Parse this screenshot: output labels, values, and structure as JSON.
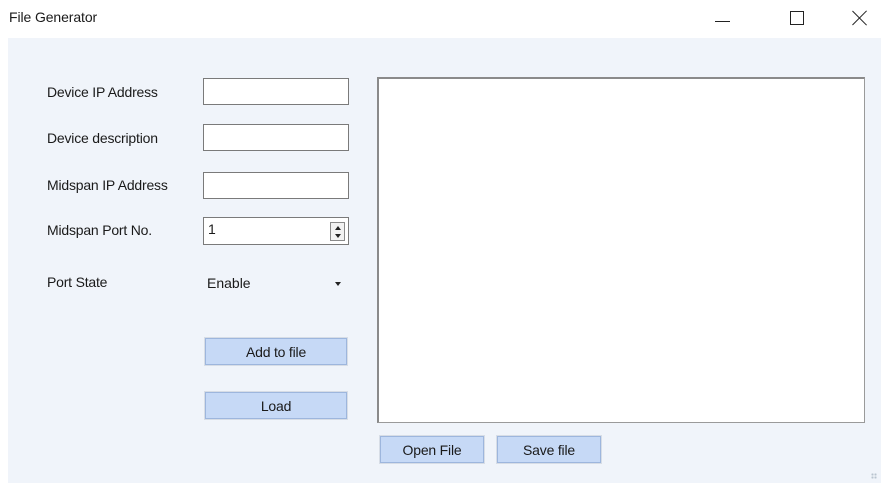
{
  "window": {
    "title": "File Generator"
  },
  "form": {
    "device_ip_label": "Device IP Address",
    "device_ip_value": "",
    "device_desc_label": "Device description",
    "device_desc_value": "",
    "midspan_ip_label": "Midspan IP Address",
    "midspan_ip_value": "",
    "midspan_port_label": "Midspan Port No.",
    "midspan_port_value": "1",
    "port_state_label": "Port State",
    "port_state_value": "Enable"
  },
  "buttons": {
    "add_to_file": "Add to file",
    "load": "Load",
    "open_file": "Open File",
    "save_file": "Save file"
  },
  "output": {
    "text": ""
  },
  "colors": {
    "client_bg": "#f0f4fa",
    "button_bg": "#c6d9f6",
    "button_border": "#9db6dd"
  },
  "icons": {
    "minimize": "minimize-icon",
    "maximize": "maximize-icon",
    "close": "close-icon",
    "spin_up": "arrow-up-icon",
    "spin_down": "arrow-down-icon",
    "dropdown": "chevron-down-icon",
    "resize_grip": "resize-grip-icon"
  }
}
